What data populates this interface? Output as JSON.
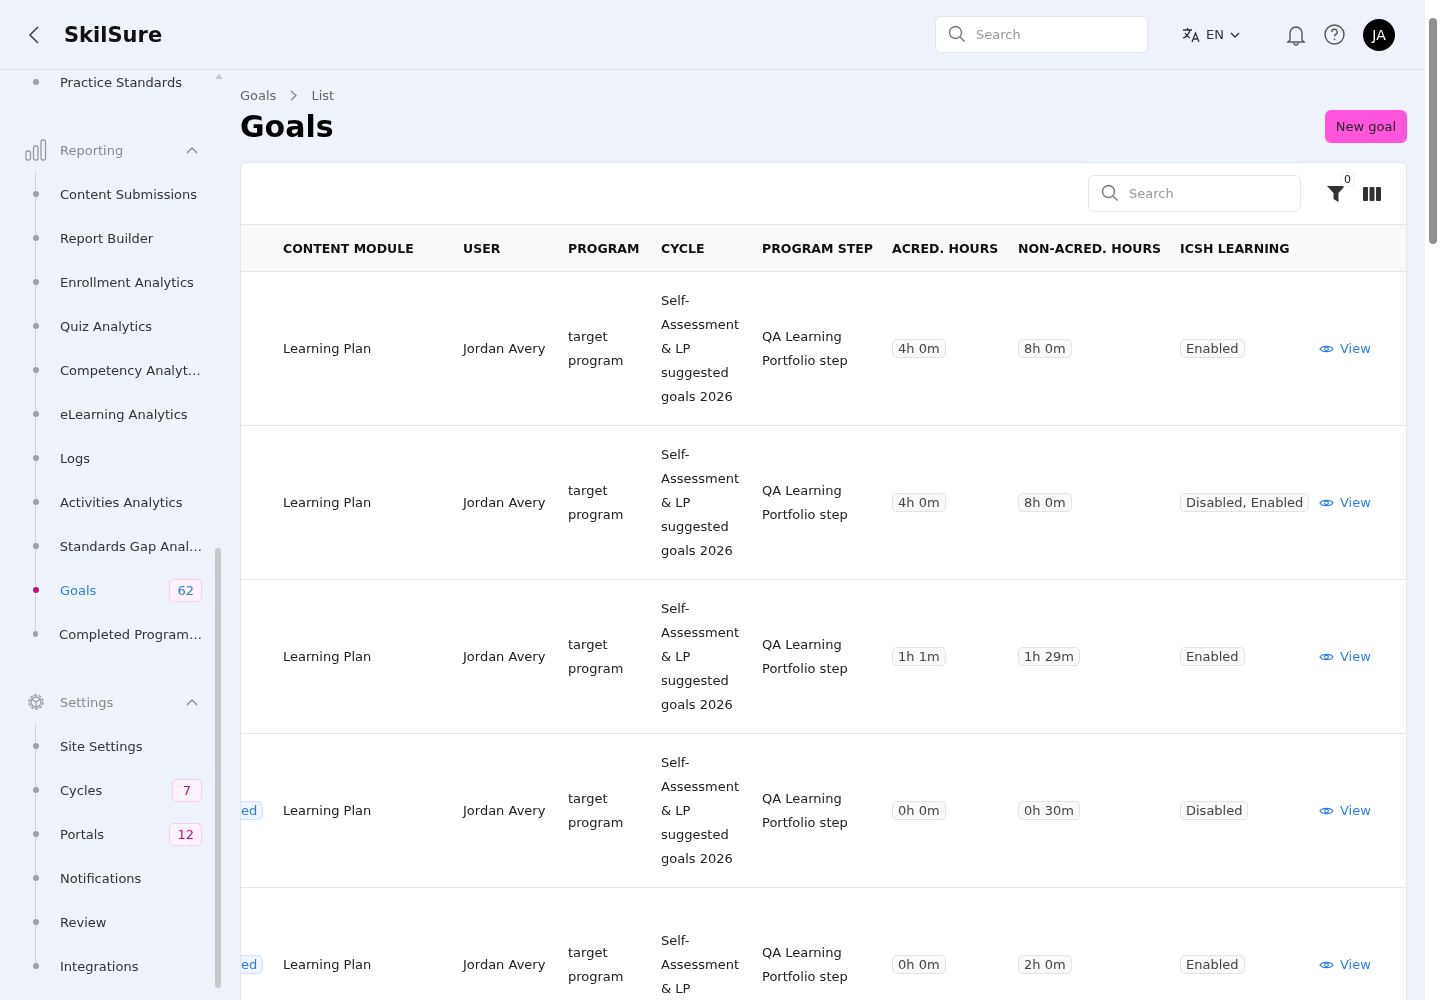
{
  "header": {
    "logo": "SkilSure",
    "search": {
      "placeholder": "Search"
    },
    "language": "EN",
    "avatar": "JA"
  },
  "sidebar": {
    "sections": [
      {
        "items": [
          {
            "label": "Practice Standards",
            "selected": false
          }
        ]
      },
      {
        "title": "Reporting",
        "kind": "chart",
        "expanded": true,
        "items": [
          {
            "label": "Content Submissions",
            "selected": false
          },
          {
            "label": "Report Builder",
            "selected": false
          },
          {
            "label": "Enrollment Analytics",
            "selected": false
          },
          {
            "label": "Quiz Analytics",
            "selected": false
          },
          {
            "label": "Competency Analyt…",
            "selected": false
          },
          {
            "label": "eLearning Analytics",
            "selected": false
          },
          {
            "label": "Logs",
            "selected": false
          },
          {
            "label": "Activities Analytics",
            "selected": false
          },
          {
            "label": "Standards Gap Anal…",
            "selected": false
          },
          {
            "label": "Goals",
            "selected": true,
            "badge": "62"
          },
          {
            "label": "Completed Program…",
            "selected": false
          }
        ]
      },
      {
        "title": "Settings",
        "kind": "gear",
        "expanded": true,
        "items": [
          {
            "label": "Site Settings",
            "selected": false
          },
          {
            "label": "Cycles",
            "selected": false,
            "badge": "7"
          },
          {
            "label": "Portals",
            "selected": false,
            "badge": "12"
          },
          {
            "label": "Notifications",
            "selected": false
          },
          {
            "label": "Review",
            "selected": false
          },
          {
            "label": "Integrations",
            "selected": false
          }
        ]
      }
    ]
  },
  "breadcrumb": [
    "Goals",
    "List"
  ],
  "title": "Goals",
  "new_button": "New goal",
  "table": {
    "search": {
      "placeholder": "Search"
    },
    "filter_count": "0",
    "columns": [
      "CONTENT MODULE",
      "USER",
      "PROGRAM",
      "CYCLE",
      "PROGRAM STEP",
      "ACRED. HOURS",
      "NON-ACRED. HOURS",
      "ICSH LEARNING"
    ],
    "rows": [
      {
        "content_module": "Learning Plan",
        "user": "Jordan Avery",
        "program": "target program",
        "cycle": "Self- Assessment & LP suggested goals 2026",
        "program_step": "QA Learning Portfolio step",
        "acred_hours": "4h 0m",
        "non_acred_hours": "8h 0m",
        "icsh_learning": "Enabled",
        "action": "View"
      },
      {
        "content_module": "Learning Plan",
        "user": "Jordan Avery",
        "program": "target program",
        "cycle": "Self- Assessment & LP suggested goals 2026",
        "program_step": "QA Learning Portfolio step",
        "acred_hours": "4h 0m",
        "non_acred_hours": "8h 0m",
        "icsh_learning": "Disabled, Enabled",
        "action": "View"
      },
      {
        "content_module": "Learning Plan",
        "user": "Jordan Avery",
        "program": "target program",
        "cycle": "Self- Assessment & LP suggested goals 2026",
        "program_step": "QA Learning Portfolio step",
        "acred_hours": "1h 1m",
        "non_acred_hours": "1h 29m",
        "icsh_learning": "Enabled",
        "action": "View"
      },
      {
        "column_1": "ed",
        "content_module": "Learning Plan",
        "user": "Jordan Avery",
        "program": "target program",
        "cycle": "Self- Assessment & LP suggested goals 2026",
        "program_step": "QA Learning Portfolio step",
        "acred_hours": "0h 0m",
        "non_acred_hours": "0h 30m",
        "icsh_learning": "Disabled",
        "action": "View"
      },
      {
        "column_1": "ed",
        "content_module": "Learning Plan",
        "user": "Jordan Avery",
        "program": "target program",
        "cycle": "Self- Assessment & LP",
        "program_step": "QA Learning Portfolio step",
        "acred_hours": "0h 0m",
        "non_acred_hours": "2h 0m",
        "icsh_learning": "Enabled",
        "action": "View"
      }
    ]
  }
}
